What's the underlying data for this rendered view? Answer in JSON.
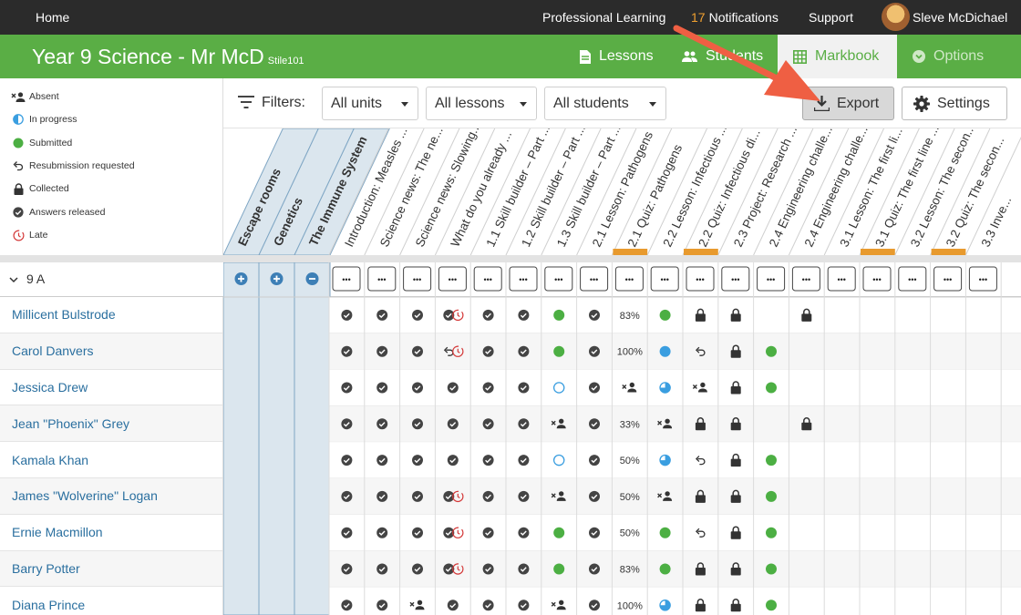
{
  "topbar": {
    "home": "Home",
    "professional_learning": "Professional Learning",
    "notifications_count": "17",
    "notifications_label": "Notifications",
    "support": "Support",
    "user_name": "Sleve McDichael"
  },
  "classbar": {
    "title": "Year 9 Science - Mr McD",
    "subtitle": "Stile101",
    "tabs": {
      "lessons": "Lessons",
      "students": "Students",
      "markbook": "Markbook",
      "options": "Options"
    }
  },
  "legend": {
    "absent": "Absent",
    "in_progress": "In progress",
    "submitted": "Submitted",
    "resubmission": "Resubmission requested",
    "collected": "Collected",
    "answers_released": "Answers released",
    "late": "Late"
  },
  "filters": {
    "label": "Filters:",
    "units": "All units",
    "lessons": "All lessons",
    "students": "All students"
  },
  "buttons": {
    "export": "Export",
    "settings": "Settings"
  },
  "colors": {
    "brand_green": "#5aae45",
    "status_green": "#4caf43",
    "status_blue": "#3a9ee0",
    "late_red": "#d43a3a",
    "unit_header_blue": "#dbe6ee",
    "highlight_orange": "#e89a2e",
    "arrow": "#ef5f43"
  },
  "units": [
    "Escape rooms",
    "Genetics",
    "The Immune System"
  ],
  "unit_toggles": [
    "plus",
    "plus",
    "minus"
  ],
  "lessons": [
    {
      "title": "Introduction: Measles ...",
      "highlight": false
    },
    {
      "title": "Science news: The ne...",
      "highlight": false
    },
    {
      "title": "Science news: Slowing...",
      "highlight": false
    },
    {
      "title": "What do you already ...",
      "highlight": false
    },
    {
      "title": "1.1 Skill builder – Part ...",
      "highlight": false
    },
    {
      "title": "1.2 Skill builder – Part ...",
      "highlight": false
    },
    {
      "title": "1.3 Skill builder – Part ...",
      "highlight": false
    },
    {
      "title": "2.1 Lesson: Pathogens",
      "highlight": false
    },
    {
      "title": "2.1 Quiz: Pathogens",
      "highlight": true
    },
    {
      "title": "2.2 Lesson: Infectious ...",
      "highlight": false
    },
    {
      "title": "2.2 Quiz: Infectious di...",
      "highlight": true
    },
    {
      "title": "2.3 Project: Research ...",
      "highlight": false
    },
    {
      "title": "2.4 Engineering challe...",
      "highlight": false
    },
    {
      "title": "2.4 Engineering challe...",
      "highlight": false
    },
    {
      "title": "3.1 Lesson: The first li...",
      "highlight": false
    },
    {
      "title": "3.1 Quiz: The first line ...",
      "highlight": true
    },
    {
      "title": "3.2 Lesson: The secon...",
      "highlight": false
    },
    {
      "title": "3.2 Quiz: The secon...",
      "highlight": true
    },
    {
      "title": "3.3 Inve...",
      "highlight": false
    }
  ],
  "more_label": "•••",
  "group": {
    "name": "9 A"
  },
  "students": [
    {
      "name": "Millicent Bulstrode",
      "cells": [
        "ar",
        "ar",
        "ar",
        "ar+late",
        "ar",
        "ar",
        "sub",
        "ar",
        "83%",
        "sub",
        "col",
        "col",
        "",
        "col",
        "",
        "",
        "",
        "",
        ""
      ]
    },
    {
      "name": "Carol Danvers",
      "cells": [
        "ar",
        "ar",
        "ar",
        "resub+late",
        "ar",
        "ar",
        "sub",
        "ar",
        "100%",
        "blue",
        "resub",
        "col",
        "sub",
        "",
        "",
        "",
        "",
        "",
        ""
      ]
    },
    {
      "name": "Jessica Drew",
      "cells": [
        "ar",
        "ar",
        "ar",
        "ar",
        "ar",
        "ar",
        "empty",
        "ar",
        "absent",
        "half",
        "absent",
        "col",
        "sub",
        "",
        "",
        "",
        "",
        "",
        ""
      ]
    },
    {
      "name": "Jean \"Phoenix\" Grey",
      "cells": [
        "ar",
        "ar",
        "ar",
        "ar",
        "ar",
        "ar",
        "absent",
        "ar",
        "33%",
        "absent",
        "col",
        "col",
        "",
        "col",
        "",
        "",
        "",
        "",
        ""
      ]
    },
    {
      "name": "Kamala Khan",
      "cells": [
        "ar",
        "ar",
        "ar",
        "ar",
        "ar",
        "ar",
        "empty",
        "ar",
        "50%",
        "half",
        "resub",
        "col",
        "sub",
        "",
        "",
        "",
        "",
        "",
        ""
      ]
    },
    {
      "name": "James \"Wolverine\" Logan",
      "cells": [
        "ar",
        "ar",
        "ar",
        "ar+late",
        "ar",
        "ar",
        "absent",
        "ar",
        "50%",
        "absent",
        "col",
        "col",
        "sub",
        "",
        "",
        "",
        "",
        "",
        ""
      ]
    },
    {
      "name": "Ernie Macmillon",
      "cells": [
        "ar",
        "ar",
        "ar",
        "ar+late",
        "ar",
        "ar",
        "sub",
        "ar",
        "50%",
        "sub",
        "resub",
        "col",
        "sub",
        "",
        "",
        "",
        "",
        "",
        ""
      ]
    },
    {
      "name": "Barry Potter",
      "cells": [
        "ar",
        "ar",
        "ar",
        "ar+late",
        "ar",
        "ar",
        "sub",
        "ar",
        "83%",
        "sub",
        "col",
        "col",
        "sub",
        "",
        "",
        "",
        "",
        "",
        ""
      ]
    },
    {
      "name": "Diana Prince",
      "cells": [
        "ar",
        "ar",
        "absent",
        "ar",
        "ar",
        "ar",
        "absent",
        "ar",
        "100%",
        "half",
        "col",
        "col",
        "sub",
        "",
        "",
        "",
        "",
        "",
        ""
      ]
    }
  ]
}
